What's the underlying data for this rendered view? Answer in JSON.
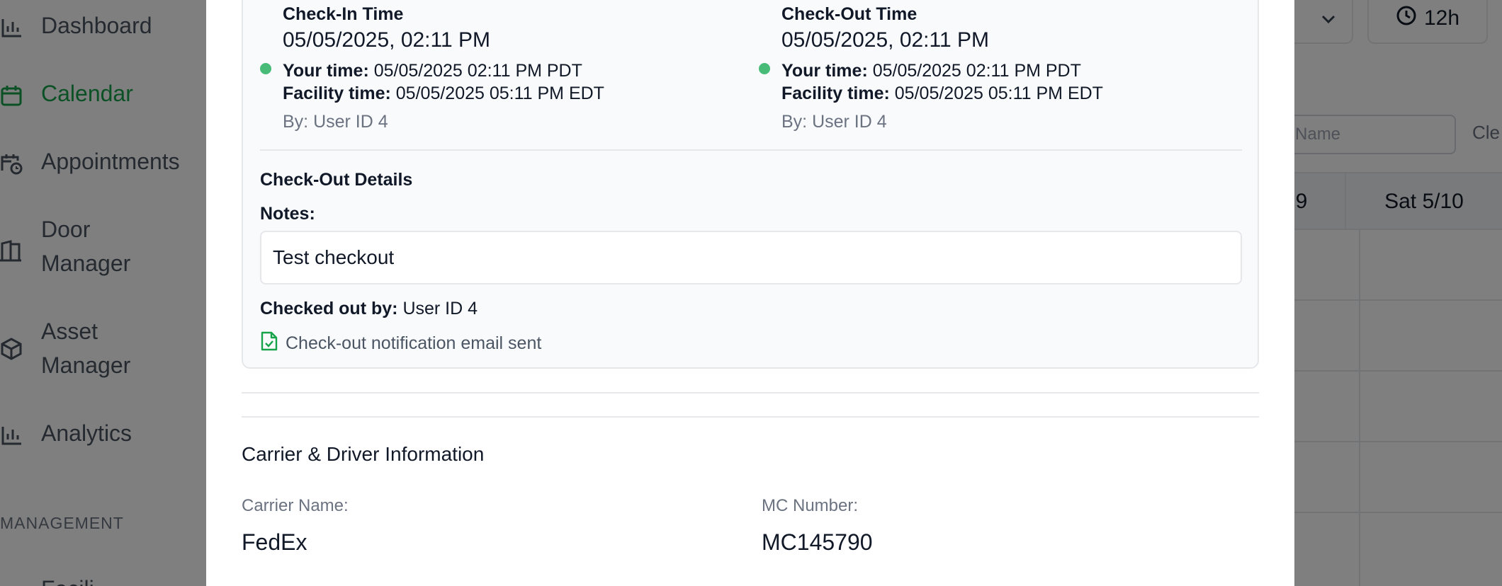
{
  "sidebar": {
    "items": [
      {
        "label": "Dashboard",
        "icon": "bar-chart-icon",
        "active": false
      },
      {
        "label": "Calendar",
        "icon": "calendar-icon",
        "active": true
      },
      {
        "label": "Appointments",
        "icon": "calendar-clock-icon",
        "active": false
      },
      {
        "label": "Door\nManager",
        "icon": "door-icon",
        "active": false
      },
      {
        "label": "Asset\nManager",
        "icon": "box-icon",
        "active": false
      },
      {
        "label": "Analytics",
        "icon": "bar-chart-icon",
        "active": false
      }
    ],
    "section_label": "MANAGEMENT",
    "cut_item_label": "Facili"
  },
  "header": {
    "time_format_button": "12h"
  },
  "calendar": {
    "search_placeholder": "er Name",
    "clear_label": "Cle",
    "day_partial": "9",
    "day_last": "Sat 5/10"
  },
  "modal": {
    "check_in": {
      "title": "Check-In Time",
      "datetime": "05/05/2025, 02:11 PM",
      "your_time_label": "Your time:",
      "your_time_value": "05/05/2025 02:11 PM PDT",
      "facility_time_label": "Facility time:",
      "facility_time_value": "05/05/2025 05:11 PM EDT",
      "by": "By: User ID 4"
    },
    "check_out": {
      "title": "Check-Out Time",
      "datetime": "05/05/2025, 02:11 PM",
      "your_time_label": "Your time:",
      "your_time_value": "05/05/2025 02:11 PM PDT",
      "facility_time_label": "Facility time:",
      "facility_time_value": "05/05/2025 05:11 PM EDT",
      "by": "By: User ID 4"
    },
    "checkout_details": {
      "title": "Check-Out Details",
      "notes_label": "Notes:",
      "notes_value": "Test checkout",
      "checked_out_by_label": "Checked out by:",
      "checked_out_by_value": "User ID 4",
      "email_status": "Check-out notification email sent"
    },
    "carrier": {
      "title": "Carrier & Driver Information",
      "carrier_name_label": "Carrier Name:",
      "carrier_name_value": "FedEx",
      "mc_number_label": "MC Number:",
      "mc_number_value": "MC145790"
    }
  },
  "colors": {
    "accent_green": "#16a34a",
    "status_dot": "#48bb78",
    "overlay": "rgba(0,0,0,0.5)"
  }
}
